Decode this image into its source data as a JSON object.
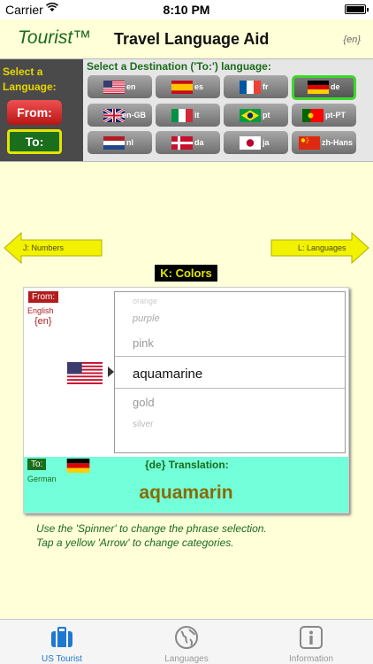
{
  "status_bar": {
    "carrier": "Carrier",
    "time": "8:10 PM"
  },
  "header": {
    "brand": "Tourist™",
    "title": "Travel Language Aid",
    "lang_code": "{en}"
  },
  "selector": {
    "select_label": "Select a Language:",
    "from_label": "From:",
    "to_label": "To:",
    "destination_label": "Select a Destination ('To:') language:",
    "languages": [
      {
        "code": "en",
        "flag": "us-flag"
      },
      {
        "code": "es",
        "flag": "spain-flag"
      },
      {
        "code": "fr",
        "flag": "france-flag"
      },
      {
        "code": "de",
        "flag": "germany-flag",
        "selected": true
      },
      {
        "code": "en-GB",
        "flag": "uk-flag"
      },
      {
        "code": "it",
        "flag": "italy-flag"
      },
      {
        "code": "pt",
        "flag": "brazil-flag"
      },
      {
        "code": "pt-PT",
        "flag": "portugal-flag"
      },
      {
        "code": "nl",
        "flag": "netherlands-flag"
      },
      {
        "code": "da",
        "flag": "denmark-flag"
      },
      {
        "code": "ja",
        "flag": "japan-flag"
      },
      {
        "code": "zh-Hans",
        "flag": "china-flag"
      }
    ]
  },
  "nav": {
    "left_label": "J: Numbers",
    "right_label": "L: Languages"
  },
  "category": "K: Colors",
  "card": {
    "from_tag": "From:",
    "from_language": "English",
    "from_code": "{en}",
    "spinner_items": [
      "orange",
      "purple",
      "pink",
      "aquamarine",
      "gold",
      "silver"
    ],
    "selected_phrase": "aquamarine",
    "to_tag": "To:",
    "to_language": "German",
    "translation_label": "{de} Translation:",
    "translation": "aquamarin"
  },
  "help": {
    "line1": "Use the 'Spinner' to change the phrase selection.",
    "line2": "Tap a yellow 'Arrow' to change categories."
  },
  "tabs": [
    {
      "label": "US Tourist",
      "icon": "suitcase-icon",
      "active": true
    },
    {
      "label": "Languages",
      "icon": "globe-icon"
    },
    {
      "label": "Information",
      "icon": "info-icon"
    }
  ],
  "colors": {
    "accent_green": "#1b6b1b",
    "from_red": "#b21c1c",
    "yellow": "#e4e400",
    "translation_bg": "#73ffd9",
    "tab_active": "#1e78d2"
  }
}
